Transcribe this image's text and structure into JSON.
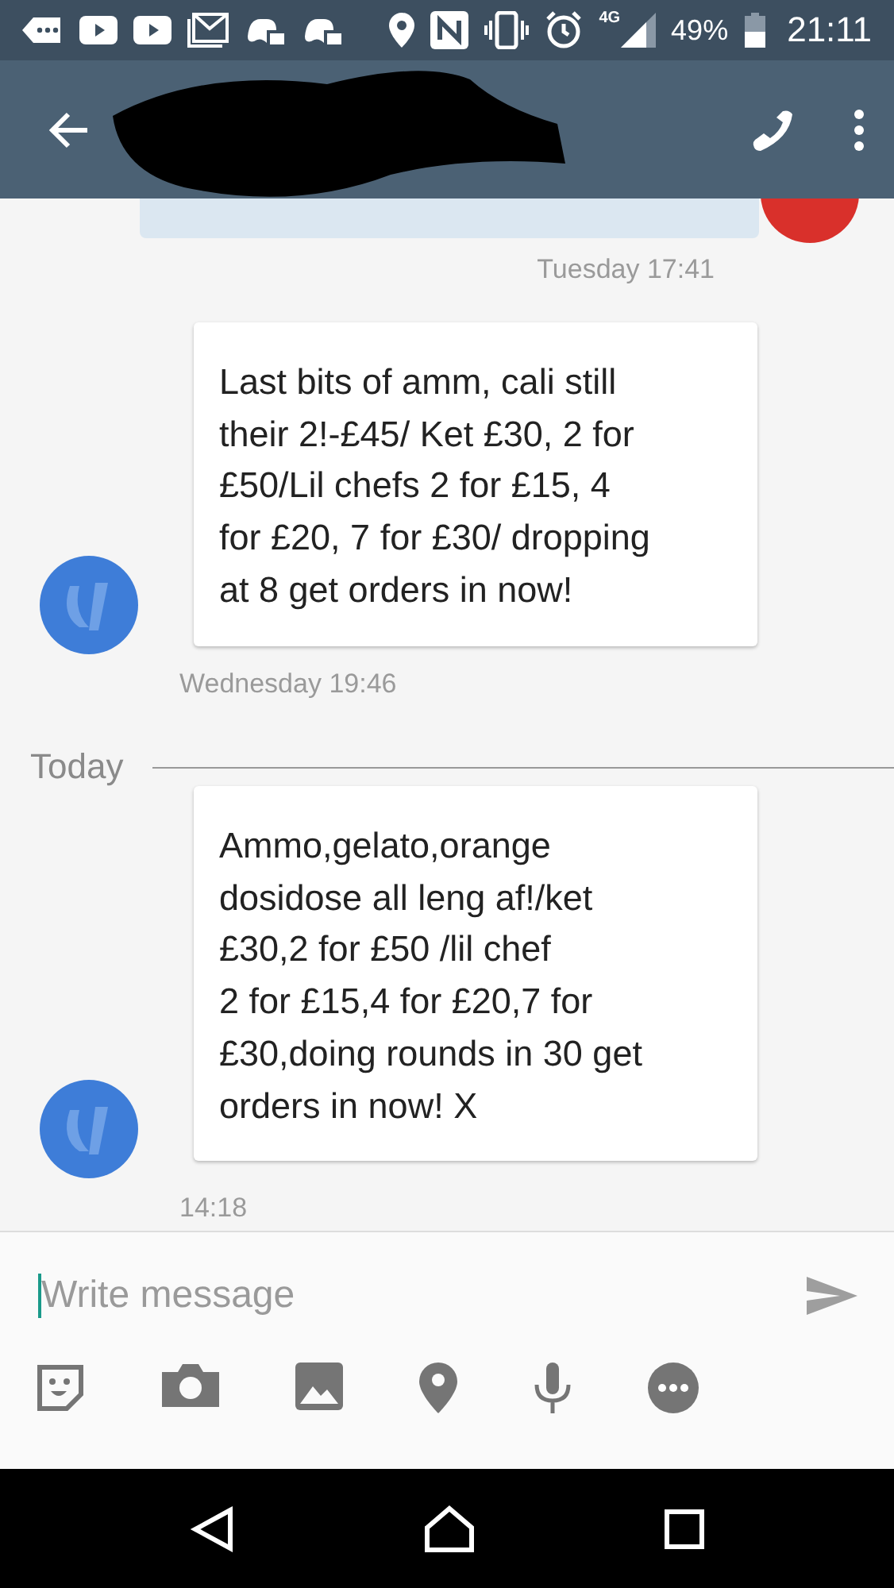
{
  "status_bar": {
    "network": "4G",
    "battery": "49%",
    "time": "21:11"
  },
  "messages": [
    {
      "kind": "sent_partial",
      "timestamp": "Tuesday 17:41"
    },
    {
      "kind": "received",
      "text": "Last bits of amm, cali still\ntheir 2!-£45/ Ket £30, 2 for\n£50/Lil chefs 2 for £15, 4\nfor £20, 7 for £30/ dropping\nat 8 get orders in now!",
      "timestamp": "Wednesday 19:46"
    },
    {
      "kind": "divider",
      "label": "Today"
    },
    {
      "kind": "received",
      "text": "Ammo,gelato,orange\ndosidose all leng af!/ket\n£30,2  for £50 /lil chef\n2 for £15,4 for £20,7 for\n£30,doing rounds in 30 get\norders in now! X",
      "timestamp": "14:18"
    }
  ],
  "compose": {
    "placeholder": "Write message"
  }
}
